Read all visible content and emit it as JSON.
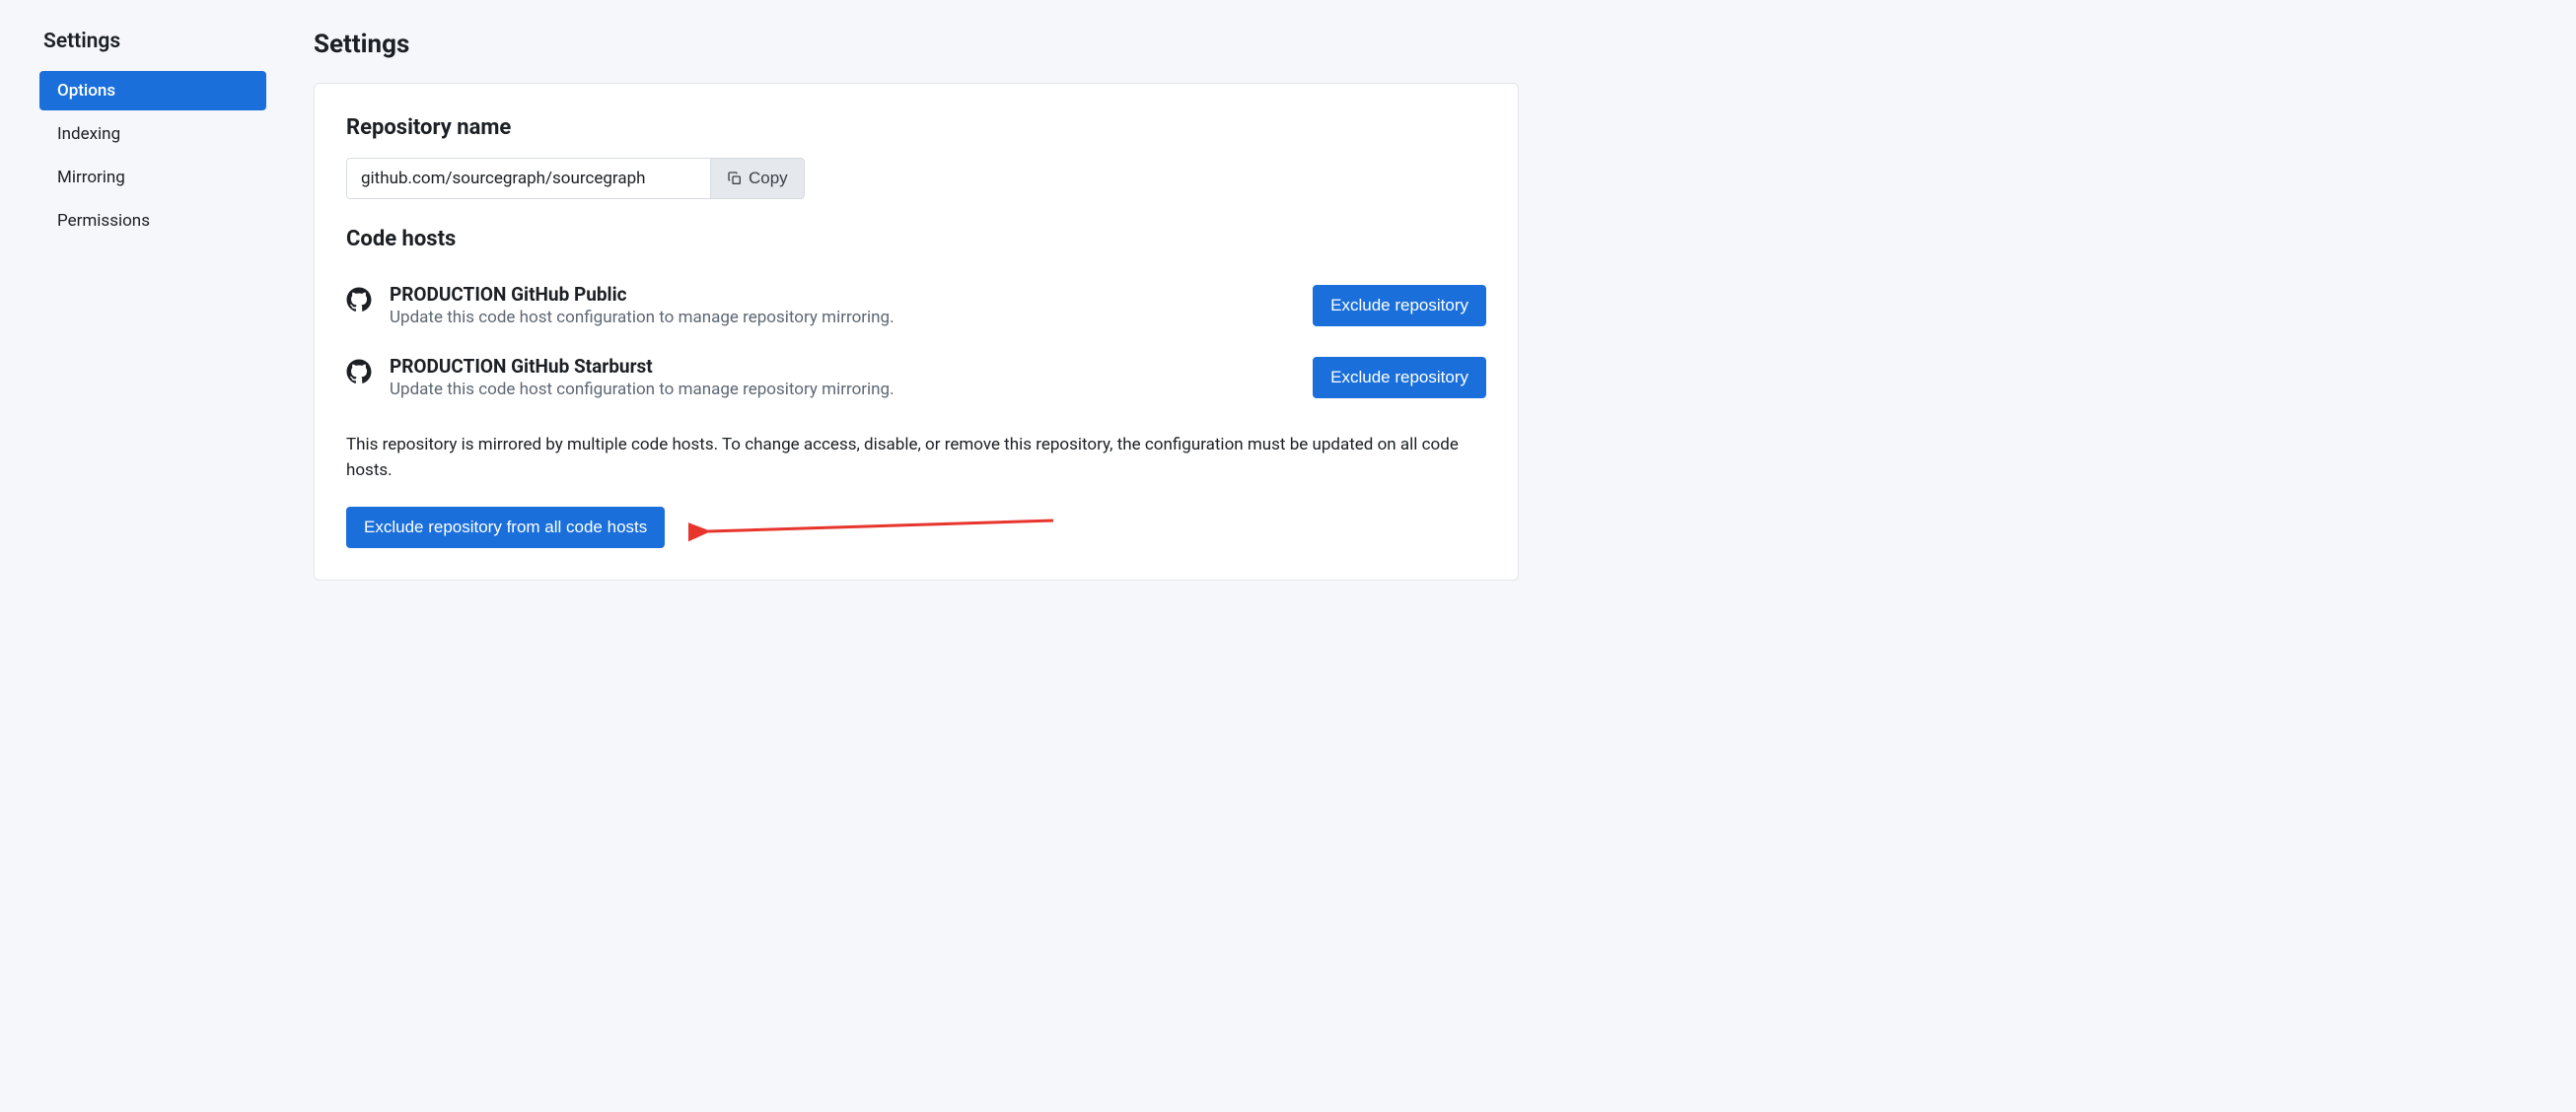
{
  "sidebar": {
    "title": "Settings",
    "items": [
      {
        "label": "Options",
        "active": true
      },
      {
        "label": "Indexing",
        "active": false
      },
      {
        "label": "Mirroring",
        "active": false
      },
      {
        "label": "Permissions",
        "active": false
      }
    ]
  },
  "page": {
    "title": "Settings"
  },
  "repo": {
    "section_title": "Repository name",
    "name": "github.com/sourcegraph/sourcegraph",
    "copy_label": "Copy"
  },
  "hosts": {
    "section_title": "Code hosts",
    "items": [
      {
        "name": "PRODUCTION GitHub Public",
        "desc": "Update this code host configuration to manage repository mirroring.",
        "exclude_label": "Exclude repository"
      },
      {
        "name": "PRODUCTION GitHub Starburst",
        "desc": "Update this code host configuration to manage repository mirroring.",
        "exclude_label": "Exclude repository"
      }
    ],
    "info_text": "This repository is mirrored by multiple code hosts. To change access, disable, or remove this repository, the configuration must be updated on all code hosts.",
    "exclude_all_label": "Exclude repository from all code hosts"
  }
}
